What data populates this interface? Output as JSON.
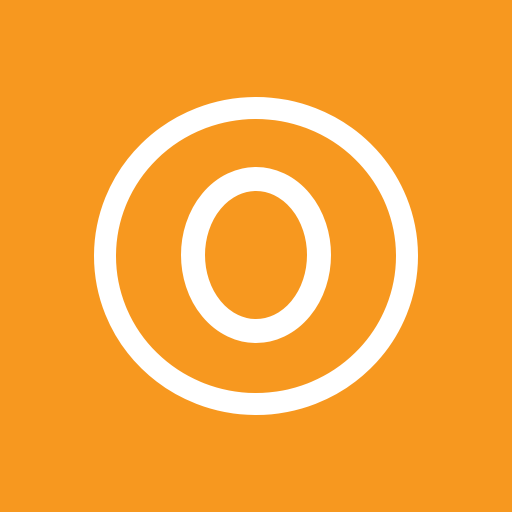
{
  "icon": {
    "name": "orange-circle-o-logo",
    "background_color": "#F7981F",
    "mark_color": "#FFFFFF"
  }
}
